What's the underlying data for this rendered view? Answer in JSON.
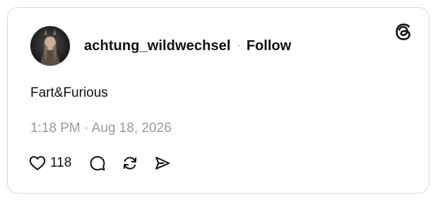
{
  "post": {
    "username": "achtung_wildwechsel",
    "separator": "·",
    "follow_label": "Follow",
    "text": "Fart&Furious",
    "timestamp": "1:18 PM · Aug 18, 2026",
    "like_count": "118"
  },
  "icons": {
    "brand": "threads-logo-icon",
    "like": "heart-icon",
    "reply": "comment-icon",
    "repost": "repost-icon",
    "share": "send-icon"
  },
  "colors": {
    "text": "#101010",
    "muted": "#9a9a9a",
    "border": "#d9d9d9",
    "background": "#ffffff"
  }
}
